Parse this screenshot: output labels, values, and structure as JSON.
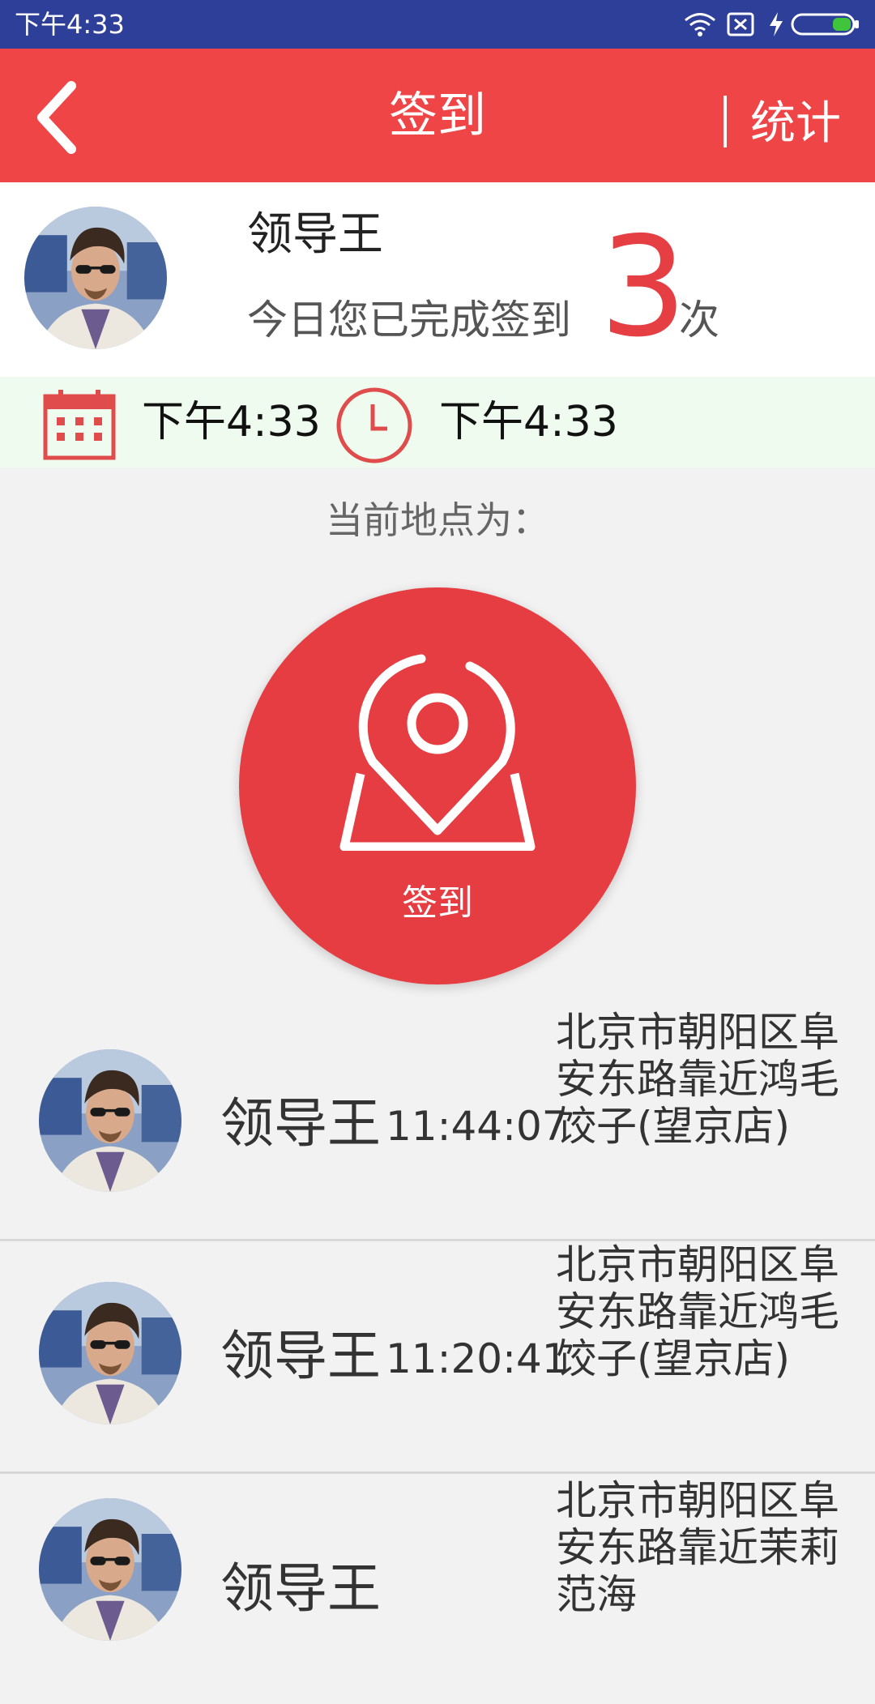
{
  "status_bar": {
    "time": "下午4:33"
  },
  "header": {
    "title": "签到",
    "stats_label": "统计"
  },
  "profile": {
    "name": "领导王",
    "done_text": "今日您已完成签到",
    "count": "3",
    "unit": "次"
  },
  "datetime": {
    "date": "下午4:33",
    "time": "下午4:33"
  },
  "location_label": "当前地点为：",
  "checkin_button": {
    "label": "签到"
  },
  "records": [
    {
      "name": "领导王",
      "time": "11:44:07",
      "address": "北京市朝阳区阜安东路靠近鸿毛饺子(望京店)"
    },
    {
      "name": "领导王",
      "time": "11:20:41",
      "address": "北京市朝阳区阜安东路靠近鸿毛饺子(望京店)"
    },
    {
      "name": "领导王",
      "time": "",
      "address": "北京市朝阳区阜安东路靠近茉莉范海"
    }
  ],
  "colors": {
    "status_bar": "#2e3f9a",
    "header": "#ef4547",
    "accent": "#e53d42",
    "date_band": "#eefbee",
    "background": "#f3f2f2"
  }
}
